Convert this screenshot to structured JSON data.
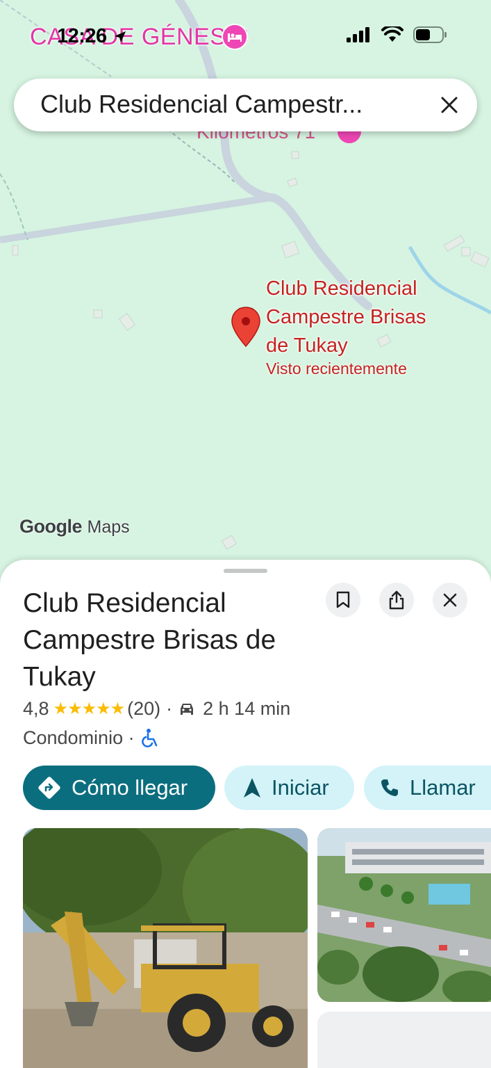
{
  "status_bar": {
    "time": "12:26"
  },
  "map": {
    "top_label": "CASA DE GÉNESIS",
    "faded_label": "Kilómetros 71",
    "pin_title": "Club Residencial Campestre Brisas de Tukay",
    "pin_subtitle": "Visto recientemente",
    "brand_google": "Google",
    "brand_maps": "Maps"
  },
  "search": {
    "query": "Club Residencial Campestr..."
  },
  "place": {
    "title": "Club Residencial Campestre Brisas de Tukay",
    "rating": "4,8",
    "stars": "★★★★★",
    "reviews": "(20)",
    "separator": "·",
    "drive_time": "2 h 14 min",
    "category": "Condominio ·"
  },
  "actions": {
    "directions": "Cómo llegar",
    "start": "Iniciar",
    "call": "Llamar"
  },
  "colors": {
    "map_bg": "#d6f4e1",
    "primary": "#0b6e7e",
    "secondary_bg": "#d3f3f8",
    "pin_red": "#ea4335",
    "pink": "#ee47b5"
  }
}
